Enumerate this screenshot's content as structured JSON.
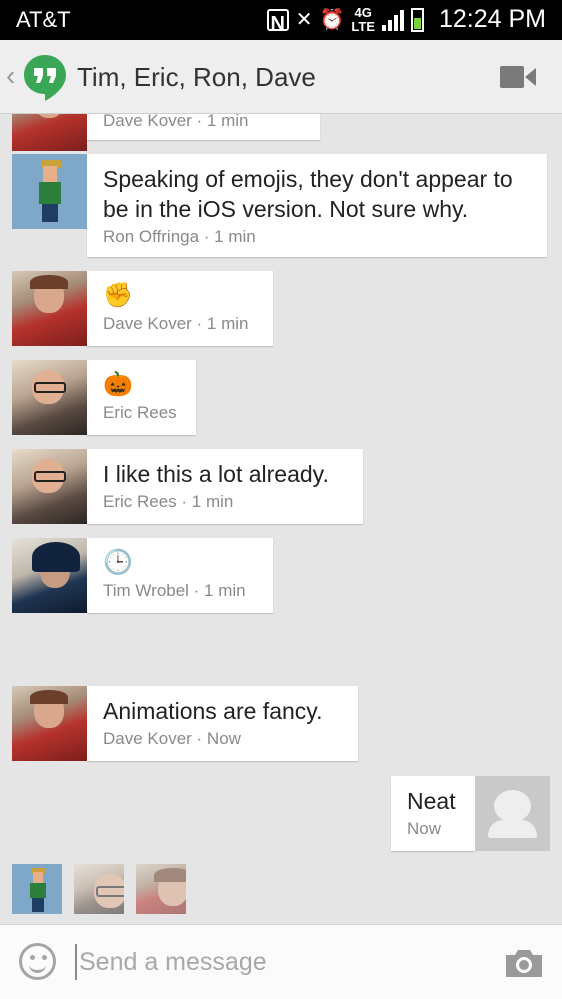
{
  "status_bar": {
    "carrier": "AT&T",
    "time": "12:24 PM",
    "network": "4G LTE",
    "icons": [
      "nfc-icon",
      "mute-icon",
      "alarm-icon",
      "lte-icon",
      "signal-icon",
      "battery-icon"
    ]
  },
  "header": {
    "title": "Tim, Eric, Ron, Dave",
    "icons": [
      "back-icon",
      "hangouts-logo",
      "video-call-icon"
    ]
  },
  "messages": [
    {
      "sender": "Dave Kover",
      "time": "1 min",
      "meta": "Dave Kover · 1 min",
      "text": ""
    },
    {
      "sender": "Ron Offringa",
      "time": "1 min",
      "meta": "Ron Offringa · 1 min",
      "text": "Speaking of emojis, they don't appear to be in the iOS version. Not sure why."
    },
    {
      "sender": "Dave Kover",
      "time": "1 min",
      "meta": "Dave Kover · 1 min",
      "emoji": "✊",
      "emoji_name": "raised-fist-emoji"
    },
    {
      "sender": "Eric Rees",
      "time": "",
      "meta": "Eric Rees",
      "emoji": "🎃",
      "emoji_name": "jack-o-lantern-emoji"
    },
    {
      "sender": "Eric Rees",
      "time": "1 min",
      "meta": "Eric Rees · 1 min",
      "text": "I like this a lot already."
    },
    {
      "sender": "Tim Wrobel",
      "time": "1 min",
      "meta": "Tim Wrobel · 1 min",
      "emoji": "🕒",
      "emoji_name": "clock-emoji"
    },
    {
      "sender": "Dave Kover",
      "time": "Now",
      "meta": "Dave Kover · Now",
      "text": "Animations are fancy."
    },
    {
      "sender": "me",
      "time": "Now",
      "meta": "Now",
      "text": "Neat"
    }
  ],
  "compose": {
    "placeholder": "Send a message"
  },
  "colors": {
    "hangouts_green": "#3aa757",
    "background": "#e5e5e5",
    "bubble": "#ffffff",
    "meta_text": "#8a8a8a"
  }
}
